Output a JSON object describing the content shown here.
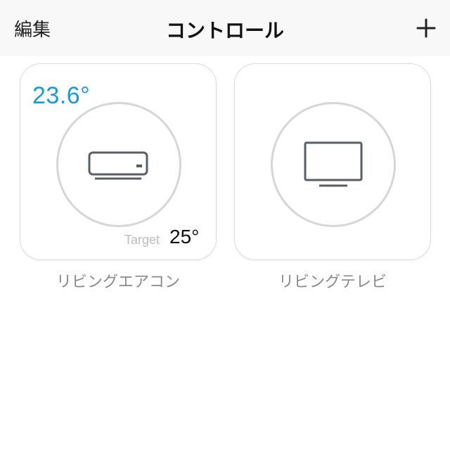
{
  "header": {
    "edit_label": "編集",
    "title": "コントロール",
    "add_icon": "plus-icon"
  },
  "devices": [
    {
      "name": "リビングエアコン",
      "type": "air-conditioner",
      "icon": "air-conditioner-icon",
      "current_temp": "23.6°",
      "target_label": "Target",
      "target_value": "25°"
    },
    {
      "name": "リビングテレビ",
      "type": "television",
      "icon": "tv-icon"
    }
  ],
  "colors": {
    "temp_accent": "#1a9ad6",
    "ring": "#d6d6d6",
    "icon": "#5a5f66",
    "label": "#8a8a8a"
  }
}
